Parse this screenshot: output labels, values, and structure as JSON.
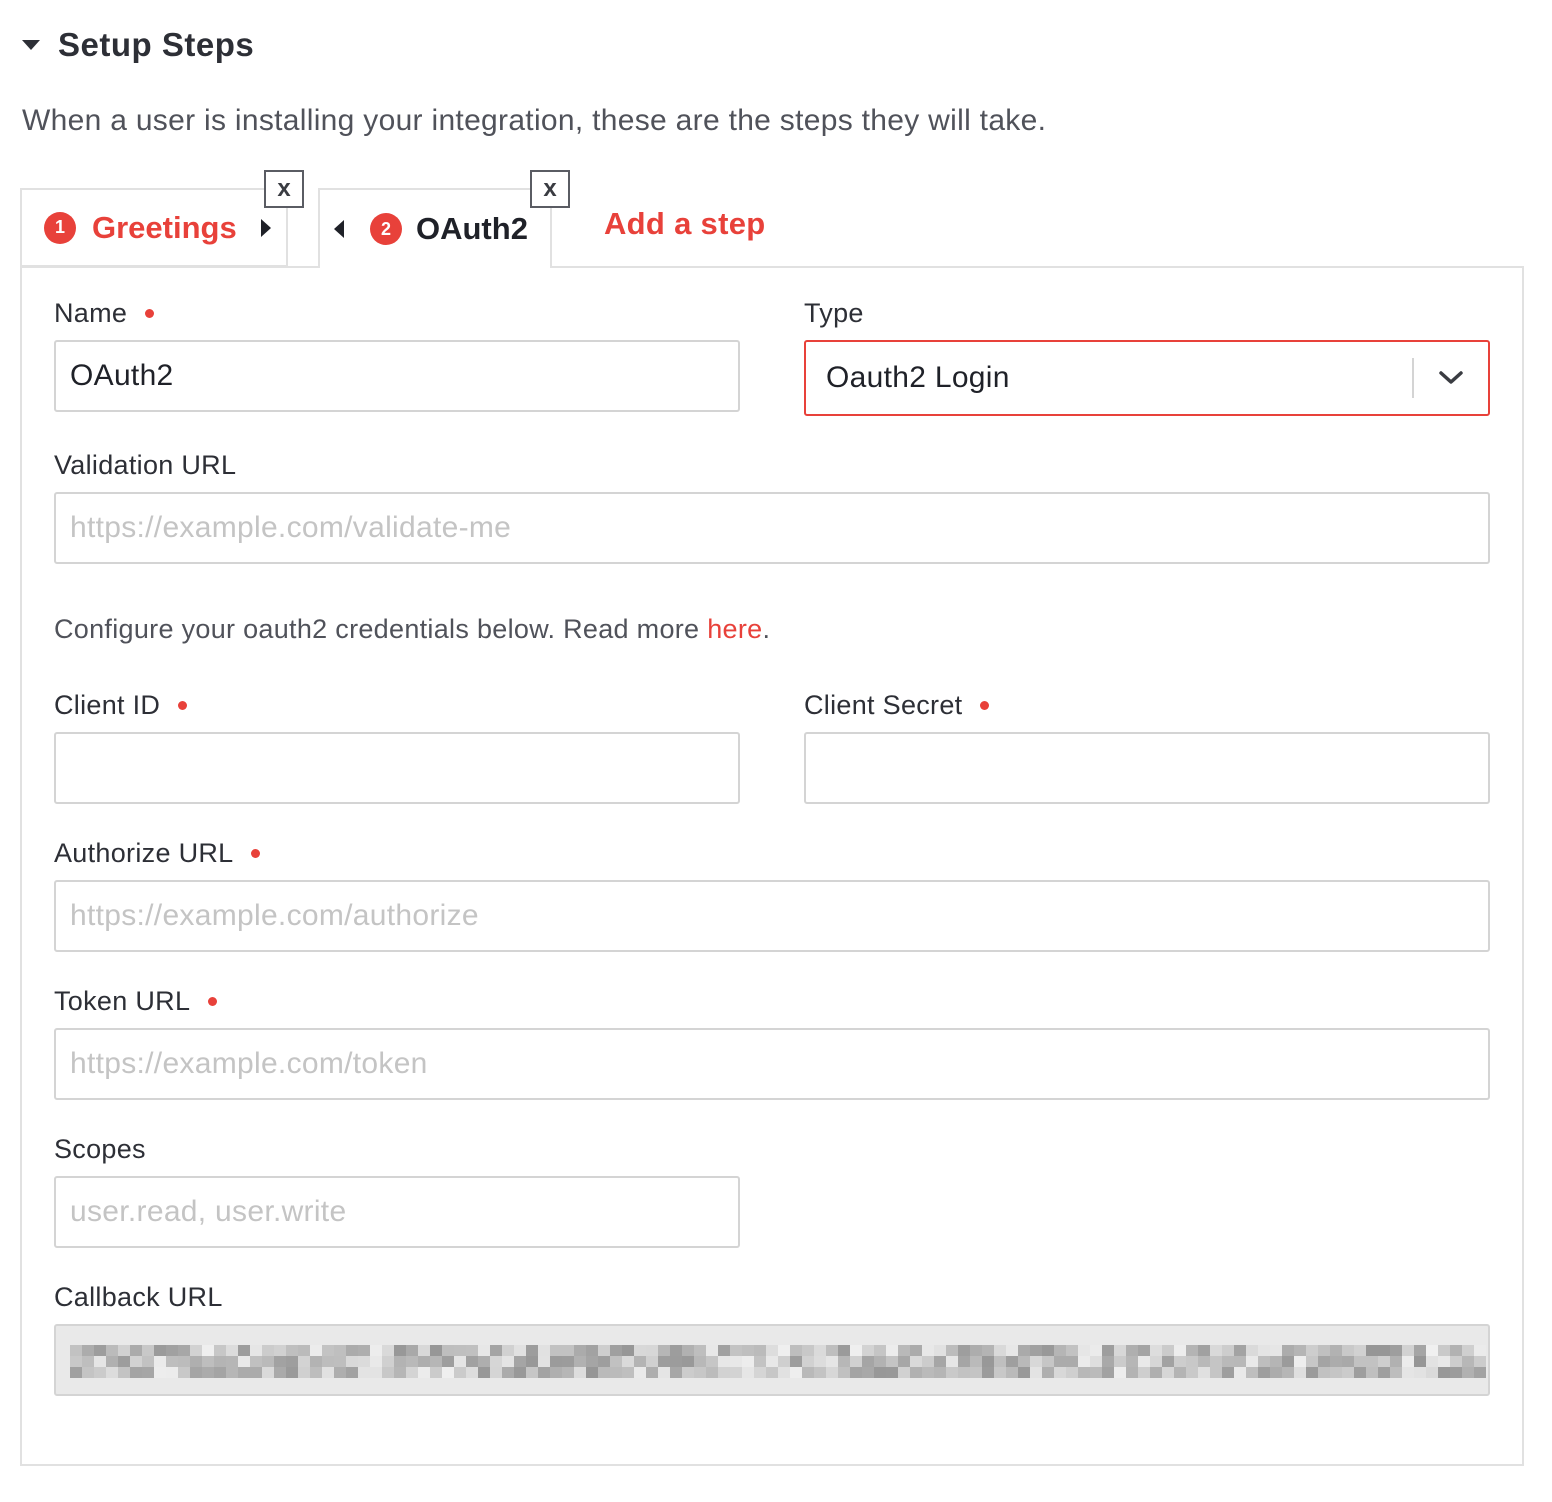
{
  "section": {
    "title": "Setup Steps",
    "description": "When a user is installing your integration, these are the steps they will take."
  },
  "tabs": [
    {
      "number": "1",
      "label": "Greetings",
      "close": "x"
    },
    {
      "number": "2",
      "label": "OAuth2",
      "close": "x"
    }
  ],
  "add_step_label": "Add a step",
  "form": {
    "name": {
      "label": "Name",
      "value": "OAuth2"
    },
    "type": {
      "label": "Type",
      "value": "Oauth2 Login"
    },
    "validation_url": {
      "label": "Validation URL",
      "placeholder": "https://example.com/validate-me"
    },
    "help": {
      "text": "Configure your oauth2 credentials below. Read more ",
      "link": "here",
      "suffix": "."
    },
    "client_id": {
      "label": "Client ID"
    },
    "client_secret": {
      "label": "Client Secret"
    },
    "authorize_url": {
      "label": "Authorize URL",
      "placeholder": "https://example.com/authorize"
    },
    "token_url": {
      "label": "Token URL",
      "placeholder": "https://example.com/token"
    },
    "scopes": {
      "label": "Scopes",
      "placeholder": "user.read, user.write"
    },
    "callback_url": {
      "label": "Callback URL"
    }
  },
  "colors": {
    "accent": "#e8413a",
    "border": "#d4d4d4",
    "disabled_bg": "#e9e9e9"
  }
}
